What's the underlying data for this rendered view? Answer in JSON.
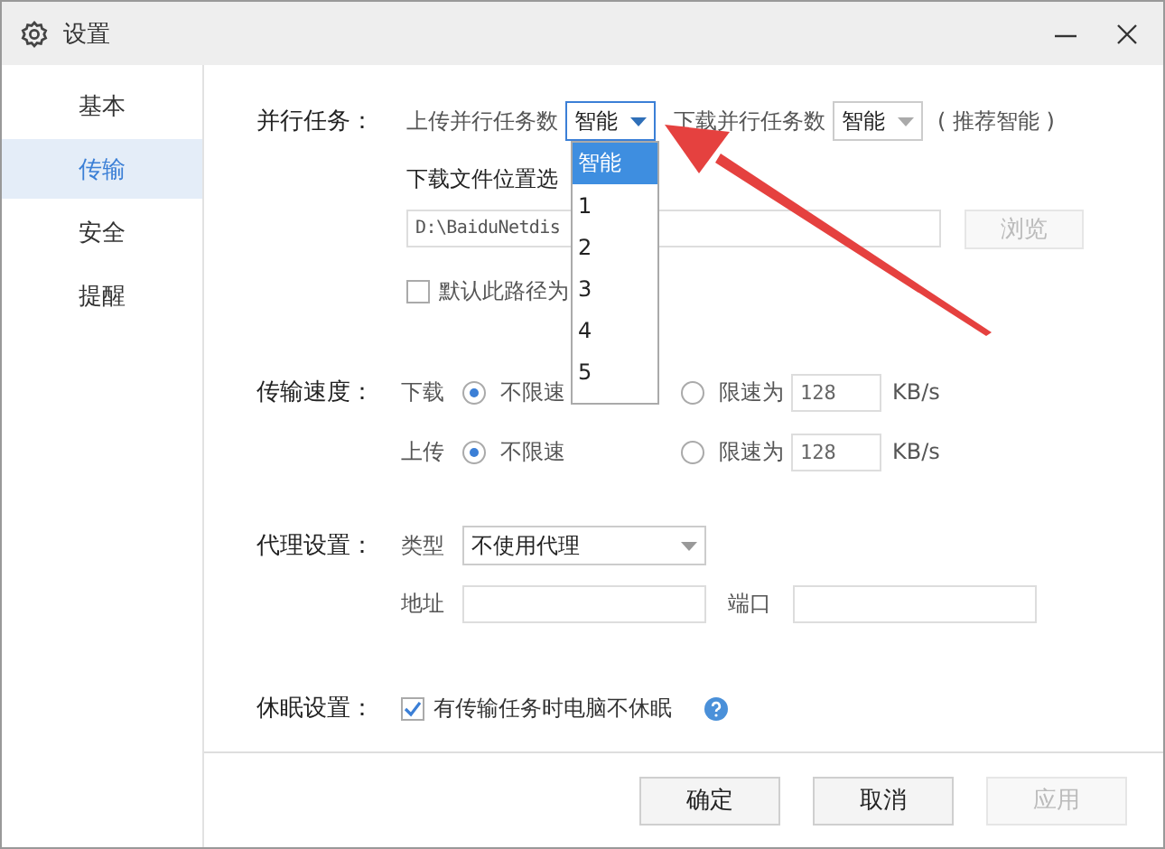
{
  "window": {
    "title": "设置"
  },
  "sidebar": {
    "items": [
      {
        "label": "基本",
        "selected": false
      },
      {
        "label": "传输",
        "selected": true
      },
      {
        "label": "安全",
        "selected": false
      },
      {
        "label": "提醒",
        "selected": false
      }
    ]
  },
  "parallel": {
    "label": "并行任务：",
    "upload_label": "上传并行任务数",
    "upload_value": "智能",
    "upload_open": true,
    "download_label": "下载并行任务数",
    "download_value": "智能",
    "hint": "( 推荐智能 )",
    "options": [
      {
        "label": "智能",
        "selected": true
      },
      {
        "label": "1",
        "selected": false
      },
      {
        "label": "2",
        "selected": false
      },
      {
        "label": "3",
        "selected": false
      },
      {
        "label": "4",
        "selected": false
      },
      {
        "label": "5",
        "selected": false
      }
    ]
  },
  "location": {
    "label": "下载文件位置选",
    "path": "D:\\BaiduNetdis",
    "browse": "浏览",
    "browse_disabled": true,
    "default_label": "默认此路径为",
    "default_checked": false
  },
  "speed": {
    "label": "传输速度：",
    "rows": [
      {
        "name": "下载",
        "unlimited_label": "不限速",
        "limit_label": "限速为",
        "unlimited": true,
        "limit_value": "128",
        "unit": "KB/s"
      },
      {
        "name": "上传",
        "unlimited_label": "不限速",
        "limit_label": "限速为",
        "unlimited": true,
        "limit_value": "128",
        "unit": "KB/s"
      }
    ]
  },
  "proxy": {
    "label": "代理设置：",
    "type_label": "类型",
    "type_value": "不使用代理",
    "address_label": "地址",
    "port_label": "端口"
  },
  "sleep": {
    "label": "休眠设置：",
    "option": "有传输任务时电脑不休眠",
    "checked": true
  },
  "buttons": [
    {
      "label": "确定",
      "disabled": false
    },
    {
      "label": "取消",
      "disabled": false
    },
    {
      "label": "应用",
      "disabled": true
    }
  ]
}
